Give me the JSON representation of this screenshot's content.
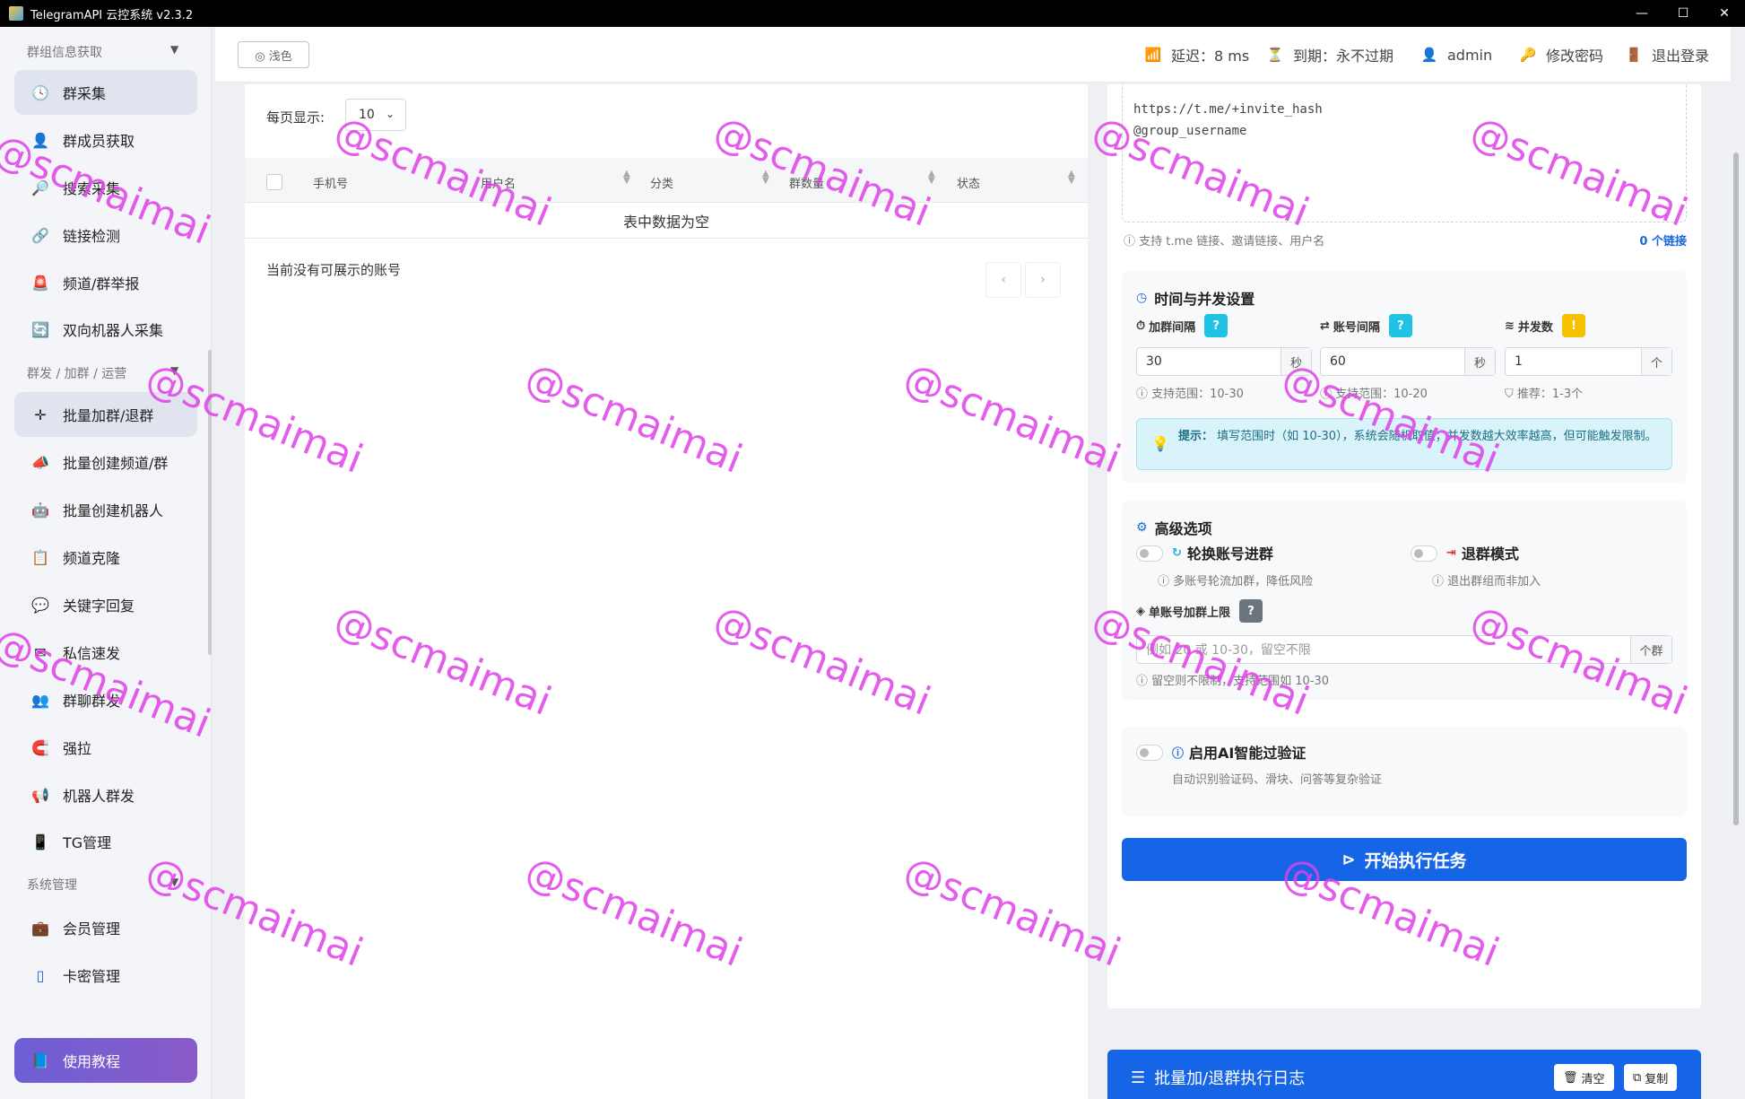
{
  "window": {
    "title": "TelegramAPI 云控系统 v2.3.2",
    "min": "—",
    "max": "☐",
    "close": "✕"
  },
  "sidebar": {
    "section1": "群组信息获取",
    "section2": "群发 / 加群 / 运营",
    "section3": "系统管理",
    "items1": [
      {
        "label": "群采集",
        "icon": "🕓"
      },
      {
        "label": "群成员获取",
        "icon": "👤"
      },
      {
        "label": "搜索采集",
        "icon": "🔎"
      },
      {
        "label": "链接检测",
        "icon": "🔗"
      },
      {
        "label": "频道/群举报",
        "icon": "🚨"
      },
      {
        "label": "双向机器人采集",
        "icon": "🔄"
      }
    ],
    "items2": [
      {
        "label": "批量加群/退群",
        "icon": "✛"
      },
      {
        "label": "批量创建频道/群",
        "icon": "📣"
      },
      {
        "label": "批量创建机器人",
        "icon": "🤖"
      },
      {
        "label": "频道克隆",
        "icon": "📋"
      },
      {
        "label": "关键字回复",
        "icon": "💬"
      },
      {
        "label": "私信速发",
        "icon": "✉"
      },
      {
        "label": "群聊群发",
        "icon": "👥"
      },
      {
        "label": "强拉",
        "icon": "🧲"
      },
      {
        "label": "机器人群发",
        "icon": "📢"
      },
      {
        "label": "TG管理",
        "icon": "📱"
      }
    ],
    "items3": [
      {
        "label": "会员管理",
        "icon": "💼"
      },
      {
        "label": "卡密管理",
        "icon": "▯"
      }
    ],
    "tutorial": {
      "label": "使用教程",
      "icon": "📘"
    }
  },
  "topbar": {
    "theme": "◎ 浅色",
    "latency": "延迟：8 ms",
    "expire": "到期：永不过期",
    "user": "admin",
    "change_password": "修改密码",
    "logout": "退出登录"
  },
  "table": {
    "page_size_label": "每页显示:",
    "page_size": "10",
    "columns": [
      "手机号",
      "用户名",
      "分类",
      "群数量",
      "状态"
    ],
    "empty": "表中数据为空",
    "no_account": "当前没有可展示的账号",
    "prev": "‹",
    "next": "›"
  },
  "links": {
    "lines": [
      "https://t.me/+invite_hash",
      "@group_username"
    ],
    "hint": "ⓘ 支持 t.me 链接、邀请链接、用户名",
    "count": "0 个链接"
  },
  "timing": {
    "title": "时间与并发设置",
    "join_interval": {
      "label": "加群间隔",
      "value": "30",
      "unit": "秒",
      "hint": "ⓘ 支持范围：10-30",
      "badge": "?"
    },
    "account_interval": {
      "label": "账号间隔",
      "value": "60",
      "unit": "秒",
      "hint": "ⓘ 支持范围：10-20",
      "badge": "?"
    },
    "concurrency": {
      "label": "并发数",
      "value": "1",
      "unit": "个",
      "hint": "推荐：1-3个",
      "badge": "!"
    },
    "tip_strong": "提示：",
    "tip": "填写范围时（如 10-30），系统会随机取值；并发数越大效率越高，但可能触发限制。"
  },
  "advanced": {
    "title": "高级选项",
    "rotate": {
      "label": "轮换账号进群",
      "hint": "ⓘ 多账号轮流加群，降低风险"
    },
    "leave": {
      "label": "退群模式",
      "hint": "ⓘ 退出群组而非加入"
    },
    "limit": {
      "label": "单账号加群上限",
      "badge": "?",
      "placeholder": "例如 20 或 10-30，留空不限",
      "unit": "个群",
      "hint": "ⓘ 留空则不限制，支持范围如 10-30"
    }
  },
  "ai": {
    "label": "启用AI智能过验证",
    "hint": "自动识别验证码、滑块、问答等复杂验证"
  },
  "start_button": "开始执行任务",
  "log": {
    "title": "批量加/退群执行日志",
    "clear": "清空",
    "copy": "复制"
  },
  "watermark": "@scmaimai"
}
